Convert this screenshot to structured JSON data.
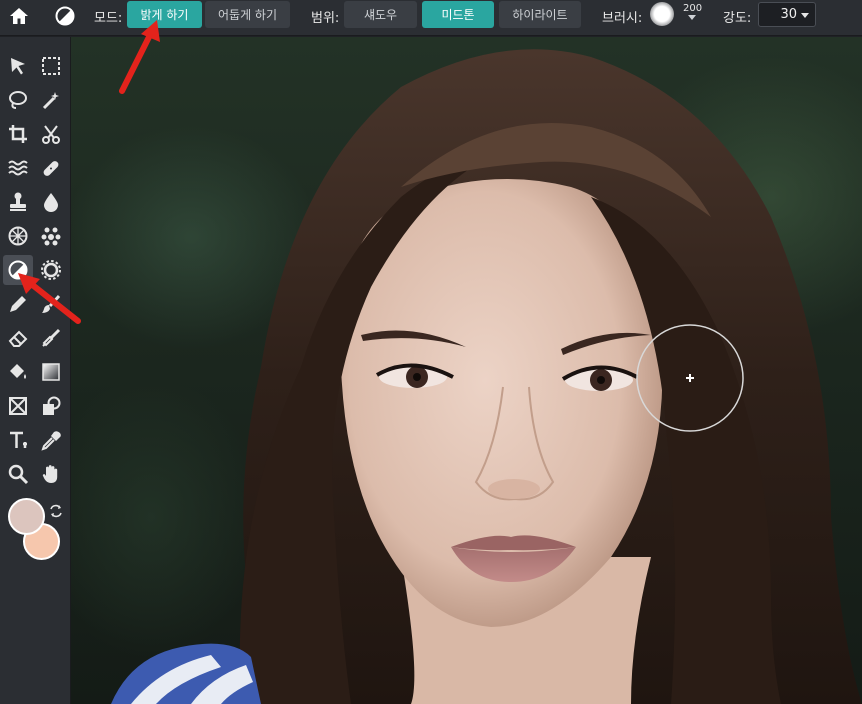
{
  "toolbar": {
    "mode_label": "모드:",
    "mode_options": [
      "밝게 하기",
      "어둡게 하기"
    ],
    "mode_selected": "밝게 하기",
    "range_label": "범위:",
    "range_options": [
      "섀도우",
      "미드톤",
      "하이라이트"
    ],
    "range_selected": "미드톤",
    "brush_label": "브러시:",
    "brush_size": "200",
    "strength_label": "강도:",
    "strength_value": "30"
  },
  "tools": [
    {
      "name": "move-tool",
      "icon": "arrow-cursor-icon"
    },
    {
      "name": "marquee-tool",
      "icon": "dashed-rect-icon"
    },
    {
      "name": "lasso-tool",
      "icon": "lasso-icon"
    },
    {
      "name": "magic-wand-tool",
      "icon": "magic-wand-icon"
    },
    {
      "name": "crop-tool",
      "icon": "crop-icon"
    },
    {
      "name": "cut-tool",
      "icon": "scissors-icon"
    },
    {
      "name": "liquify-tool",
      "icon": "waves-icon"
    },
    {
      "name": "heal-tool",
      "icon": "bandage-icon"
    },
    {
      "name": "clone-tool",
      "icon": "stamp-icon"
    },
    {
      "name": "blur-tool",
      "icon": "drop-icon"
    },
    {
      "name": "sponge-tool",
      "icon": "sponge-icon"
    },
    {
      "name": "color-replace-tool",
      "icon": "dots-icon"
    },
    {
      "name": "dodge-burn-tool",
      "icon": "dodge-burn-icon"
    },
    {
      "name": "sharpen-tool",
      "icon": "gear-icon"
    },
    {
      "name": "pencil-tool",
      "icon": "pencil-icon"
    },
    {
      "name": "brush-tool",
      "icon": "brush-icon"
    },
    {
      "name": "eraser-tool",
      "icon": "eraser-icon"
    },
    {
      "name": "color-brush-tool",
      "icon": "paint-brush-icon"
    },
    {
      "name": "fill-tool",
      "icon": "bucket-icon"
    },
    {
      "name": "gradient-tool",
      "icon": "gradient-icon"
    },
    {
      "name": "frame-tool",
      "icon": "frame-icon"
    },
    {
      "name": "shape-tool",
      "icon": "shape-icon"
    },
    {
      "name": "text-tool",
      "icon": "text-icon"
    },
    {
      "name": "eyedropper-tool",
      "icon": "eyedropper-icon"
    },
    {
      "name": "zoom-tool",
      "icon": "magnifier-icon"
    },
    {
      "name": "hand-tool",
      "icon": "hand-icon"
    }
  ],
  "active_tool": "dodge-burn-tool",
  "colors": {
    "foreground": "#dcc5be",
    "background": "#f6c7ad",
    "accent": "#2aa6a0",
    "annotation": "#e3231c"
  }
}
